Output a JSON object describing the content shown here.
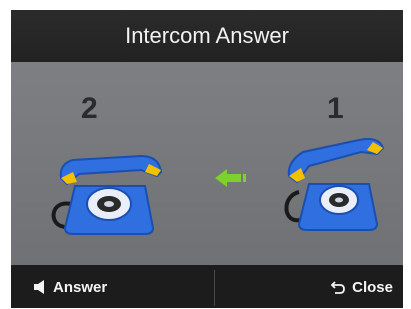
{
  "title": "Intercom Answer",
  "phones": [
    {
      "label": "2"
    },
    {
      "label": "1"
    }
  ],
  "softkeys": {
    "left": {
      "label": "Answer",
      "icon": "speaker-icon"
    },
    "right": {
      "label": "Close",
      "icon": "return-arrow-icon"
    }
  },
  "colors": {
    "phone_body": "#2f6fe0",
    "handset_accent": "#f2c200",
    "arrow": "#7ed12b"
  }
}
